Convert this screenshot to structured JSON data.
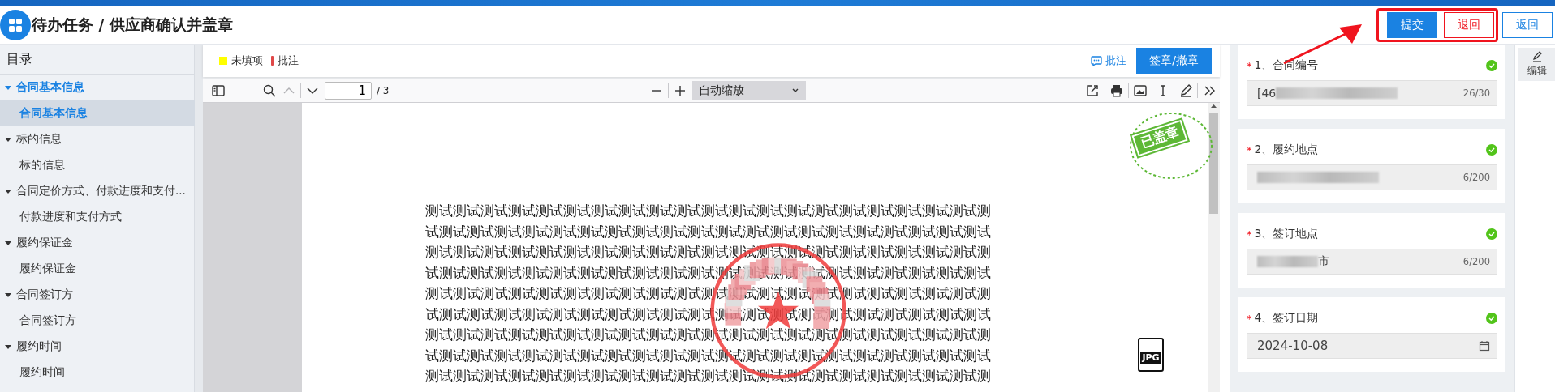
{
  "header": {
    "title": "待办任务 / 供应商确认并盖章",
    "buttons": [
      {
        "label": "提交",
        "kind": "primary"
      },
      {
        "label": "退回",
        "kind": "danger"
      },
      {
        "label": "返回",
        "kind": "outline"
      }
    ]
  },
  "toc": {
    "title": "目录",
    "items": [
      {
        "label": "合同基本信息",
        "expanded": true,
        "children": [
          {
            "label": "合同基本信息",
            "selected": true
          }
        ]
      },
      {
        "label": "标的信息",
        "expanded": true,
        "children": [
          {
            "label": "标的信息",
            "selected": false
          }
        ]
      },
      {
        "label": "合同定价方式、付款进度和支付...",
        "expanded": true,
        "children": [
          {
            "label": "付款进度和支付方式",
            "selected": false
          }
        ]
      },
      {
        "label": "履约保证金",
        "expanded": true,
        "children": [
          {
            "label": "履约保证金",
            "selected": false
          }
        ]
      },
      {
        "label": "合同签订方",
        "expanded": true,
        "children": [
          {
            "label": "合同签订方",
            "selected": false
          }
        ]
      },
      {
        "label": "履约时间",
        "expanded": true,
        "children": [
          {
            "label": "履约时间",
            "selected": false
          }
        ]
      }
    ]
  },
  "viewer": {
    "legend": [
      {
        "label": "未填项",
        "color": "#ffff00",
        "kind": "square"
      },
      {
        "label": "批注",
        "color": "#e04848",
        "kind": "bar"
      }
    ],
    "comment_link": "批注",
    "sign_button": "签章/撤章",
    "toolbar": {
      "page": "1",
      "page_count": "/ 3",
      "previous_disabled": true,
      "zoom": "自动缩放"
    },
    "page": {
      "stamp": "已盖章",
      "attachment_badge": "JPG",
      "lines": [
        "测试测试测试测试测试测试测试测试测试测试测试测试测试测试测试测试测试测试测试测试测",
        "试测试测试测试测试测试测试测试测试测试测试测试测试测试测试测试测试测试测试测试测试",
        "测试测试测试测试测试测试测试测试测试测试测试测试测试测试测试测试测试测试测试测试测",
        "试测试测试测试测试测试测试测试测试测试测试测试测试测试测试测试测试测试测试测试测试",
        "测试测试测试测试测试测试测试测试测试测试测试测试测试测试测试测试测试测试测试测试测",
        "试测试测试测试测试测试测试测试测试测试测试测试测试测试测试测试测试测试测试测试测试",
        "测试测试测试测试测试测试测试测试测试测试测试测试测试测试测试测试测试测试测试测试测",
        "试测试测试测试测试测试测试测试测试测试测试测试测试测试测试测试测试测试测试测试测试",
        "测试测试测试测试测试测试测试测试测试测试测试测试测试测试测试测试测试测试测试测试测"
      ]
    }
  },
  "form": {
    "fields": [
      {
        "mark": "*",
        "label": "1、合同编号",
        "valid": true,
        "kind": "text",
        "value_parts": [
          {
            "kind": "text",
            "text": "[46"
          },
          {
            "kind": "redacted"
          }
        ],
        "counter": "26/30"
      },
      {
        "mark": "*",
        "label": "2、履约地点",
        "valid": true,
        "kind": "text",
        "value_parts": [
          {
            "kind": "redacted"
          }
        ],
        "counter": "6/200"
      },
      {
        "mark": "*",
        "label": "3、签订地点",
        "valid": true,
        "kind": "text",
        "value_parts": [
          {
            "kind": "redacted"
          },
          {
            "kind": "text",
            "text": "市"
          }
        ],
        "counter": "6/200"
      },
      {
        "mark": "*",
        "label": "4、签订日期",
        "valid": true,
        "kind": "date",
        "value_parts": [
          {
            "kind": "text",
            "text": "2024-10-08"
          }
        ]
      }
    ]
  },
  "edit_button": "编辑"
}
